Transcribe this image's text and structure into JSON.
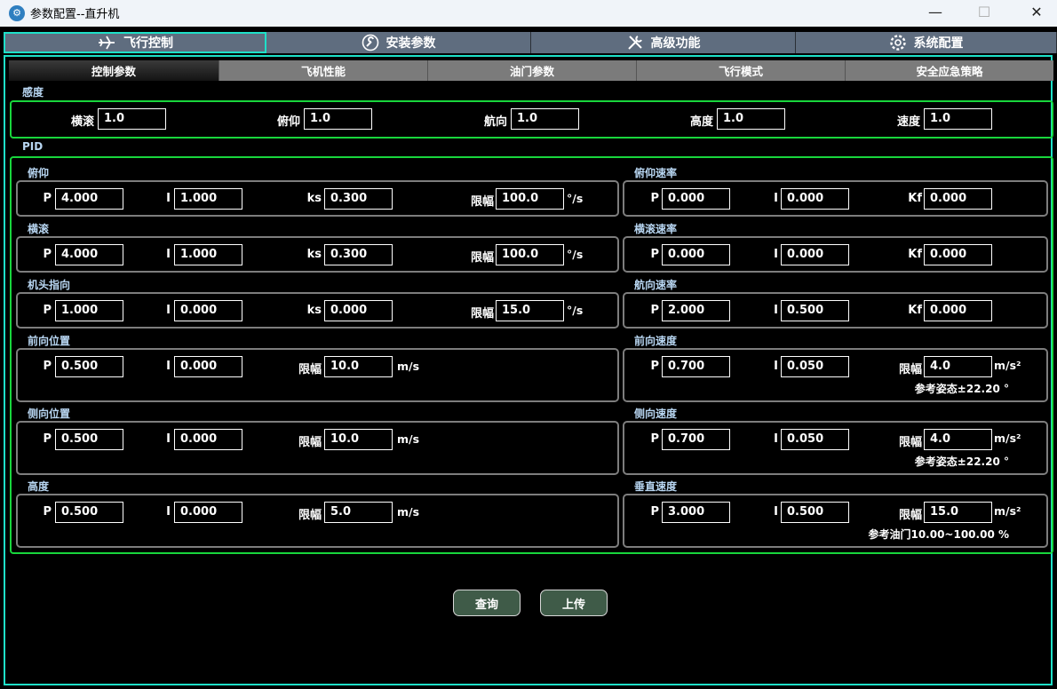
{
  "window": {
    "title": "参数配置--直升机",
    "minimize": "—",
    "maximize": "☐",
    "close": "✕"
  },
  "main_tabs": [
    {
      "label": "飞行控制",
      "icon": "airplane-icon"
    },
    {
      "label": "安装参数",
      "icon": "wrench-circle-icon"
    },
    {
      "label": "高级功能",
      "icon": "tools-icon"
    },
    {
      "label": "系统配置",
      "icon": "gear-icon"
    }
  ],
  "sub_tabs": [
    "控制参数",
    "飞机性能",
    "油门参数",
    "飞行模式",
    "安全应急策略"
  ],
  "sensitivity": {
    "title": "感度",
    "fields": [
      {
        "label": "横滚",
        "value": "1.0"
      },
      {
        "label": "俯仰",
        "value": "1.0"
      },
      {
        "label": "航向",
        "value": "1.0"
      },
      {
        "label": "高度",
        "value": "1.0"
      },
      {
        "label": "速度",
        "value": "1.0"
      }
    ]
  },
  "pid": {
    "title": "PID",
    "left_groups": [
      {
        "title": "俯仰",
        "p": "4.000",
        "i": "1.000",
        "third_label": "ks",
        "third": "0.300",
        "limit_label": "限幅",
        "limit": "100.0",
        "unit": "°/s"
      },
      {
        "title": "横滚",
        "p": "4.000",
        "i": "1.000",
        "third_label": "ks",
        "third": "0.300",
        "limit_label": "限幅",
        "limit": "100.0",
        "unit": "°/s"
      },
      {
        "title": "机头指向",
        "p": "1.000",
        "i": "0.000",
        "third_label": "ks",
        "third": "0.000",
        "limit_label": "限幅",
        "limit": "15.0",
        "unit": "°/s"
      },
      {
        "title": "前向位置",
        "p": "0.500",
        "i": "0.000",
        "limit_label": "限幅",
        "limit": "10.0",
        "unit": "m/s"
      },
      {
        "title": "侧向位置",
        "p": "0.500",
        "i": "0.000",
        "limit_label": "限幅",
        "limit": "10.0",
        "unit": "m/s"
      },
      {
        "title": "高度",
        "p": "0.500",
        "i": "0.000",
        "limit_label": "限幅",
        "limit": "5.0",
        "unit": "m/s"
      }
    ],
    "right_groups": [
      {
        "title": "俯仰速率",
        "p": "0.000",
        "i": "0.000",
        "kf_label": "Kf",
        "kf": "0.000"
      },
      {
        "title": "横滚速率",
        "p": "0.000",
        "i": "0.000",
        "kf_label": "Kf",
        "kf": "0.000"
      },
      {
        "title": "航向速率",
        "p": "2.000",
        "i": "0.500",
        "kf_label": "Kf",
        "kf": "0.000"
      },
      {
        "title": "前向速度",
        "p": "0.700",
        "i": "0.050",
        "limit_label": "限幅",
        "limit": "4.0",
        "unit": "m/s²",
        "note": "参考姿态±22.20 °"
      },
      {
        "title": "侧向速度",
        "p": "0.700",
        "i": "0.050",
        "limit_label": "限幅",
        "limit": "4.0",
        "unit": "m/s²",
        "note": "参考姿态±22.20 °"
      },
      {
        "title": "垂直速度",
        "p": "3.000",
        "i": "0.500",
        "limit_label": "限幅",
        "limit": "15.0",
        "unit": "m/s²",
        "note": "参考油门10.00~100.00 %"
      }
    ],
    "p_label": "P",
    "i_label": "I"
  },
  "buttons": {
    "query": "查询",
    "upload": "上传"
  },
  "colors": {
    "accent_teal": "#1ee0c8",
    "group_green": "#18d63c",
    "button_green": "#3f5b48",
    "tab_grey": "#5f6d7f"
  }
}
